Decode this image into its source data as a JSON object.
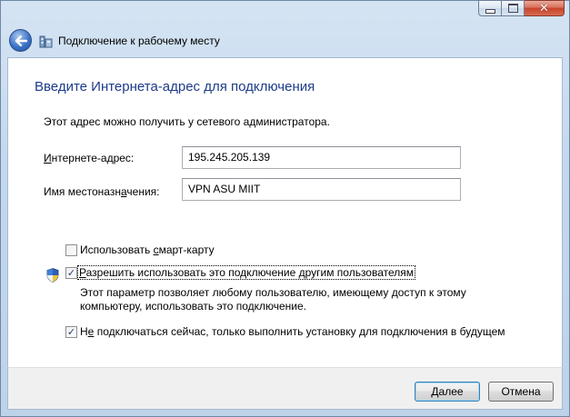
{
  "window": {
    "title": "Подключение к рабочему месту",
    "controls": {
      "minimize_icon": "minimize-icon",
      "maximize_icon": "maximize-icon",
      "close_icon": "close-icon",
      "close_glyph": "✕"
    }
  },
  "page": {
    "heading": "Введите Интернета-адрес для подключения",
    "hint": "Этот адрес можно получить у сетевого администратора."
  },
  "form": {
    "address_label_u": "И",
    "address_label_rest": "нтернете-адрес:",
    "address_value": "195.245.205.139",
    "dest_label_pre": "Имя местоназн",
    "dest_label_u": "а",
    "dest_label_post": "чения:",
    "dest_value": "VPN ASU MIIT"
  },
  "options": {
    "smartcard": {
      "pre": "Использовать ",
      "u": "с",
      "post": "март-карту",
      "checked": false
    },
    "allow_others": {
      "pre": "",
      "u": "Р",
      "post": "азрешить использовать это подключение другим пользователям",
      "checked": true,
      "description": "Этот параметр позволяет любому пользователю, имеющему доступ к этому компьютеру, использовать это подключение."
    },
    "dont_connect": {
      "pre": "Н",
      "u": "е",
      "post": " подключаться сейчас, только выполнить установку для подключения в будущем",
      "checked": true
    }
  },
  "buttons": {
    "next_u": "Д",
    "next_rest": "алее",
    "cancel": "Отмена"
  },
  "colors": {
    "heading": "#1e3b8b",
    "close_button": "#c7432a",
    "frame": "#c3d8ee"
  }
}
